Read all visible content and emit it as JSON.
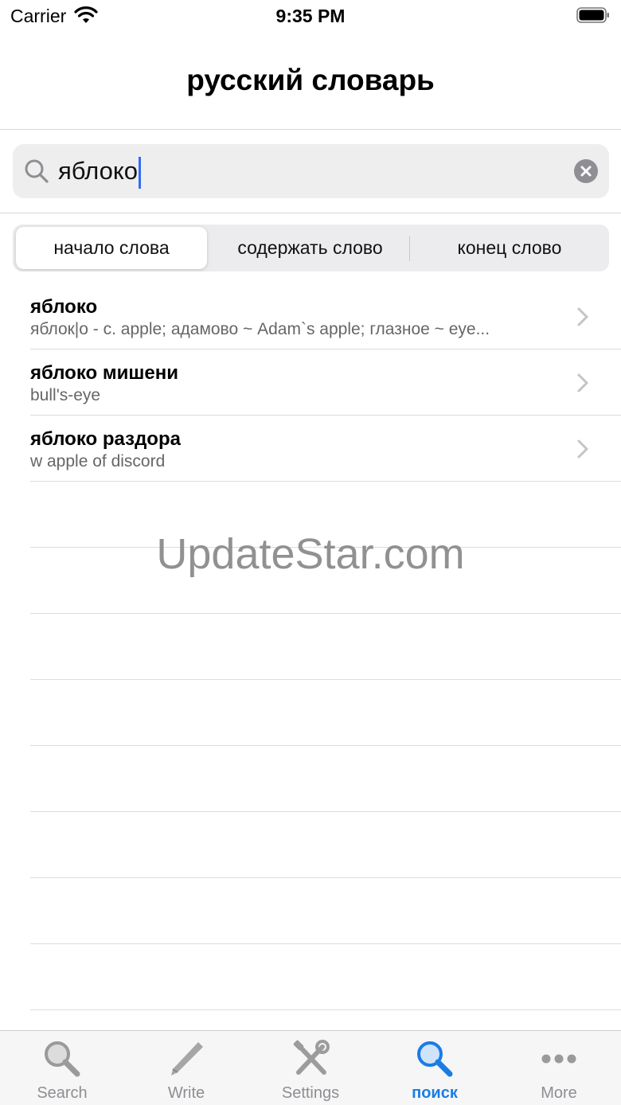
{
  "status_bar": {
    "carrier": "Carrier",
    "time": "9:35 PM"
  },
  "nav": {
    "title": "русский словарь"
  },
  "search": {
    "value": "яблоко"
  },
  "segments": [
    {
      "label": "начало слова",
      "selected": true
    },
    {
      "label": "содержать слово",
      "selected": false
    },
    {
      "label": "конец слово",
      "selected": false
    }
  ],
  "results": [
    {
      "title": "яблоко",
      "subtitle": "яблок|о - с. apple; адамово ~ Adam`s apple; глазное ~ eye..."
    },
    {
      "title": "яблоко мишени",
      "subtitle": "bull's-eye"
    },
    {
      "title": "яблоко раздора",
      "subtitle": "w apple of discord"
    }
  ],
  "watermark": "UpdateStar.com",
  "tabs": [
    {
      "label": "Search",
      "icon": "magnifier-icon"
    },
    {
      "label": "Write",
      "icon": "pencil-icon"
    },
    {
      "label": "Settings",
      "icon": "tools-icon"
    },
    {
      "label": "поиск",
      "icon": "magnifier-icon",
      "active": true
    },
    {
      "label": "More",
      "icon": "more-dots-icon"
    }
  ],
  "colors": {
    "accent": "#1a7de4",
    "caret": "#2f6cf6"
  }
}
